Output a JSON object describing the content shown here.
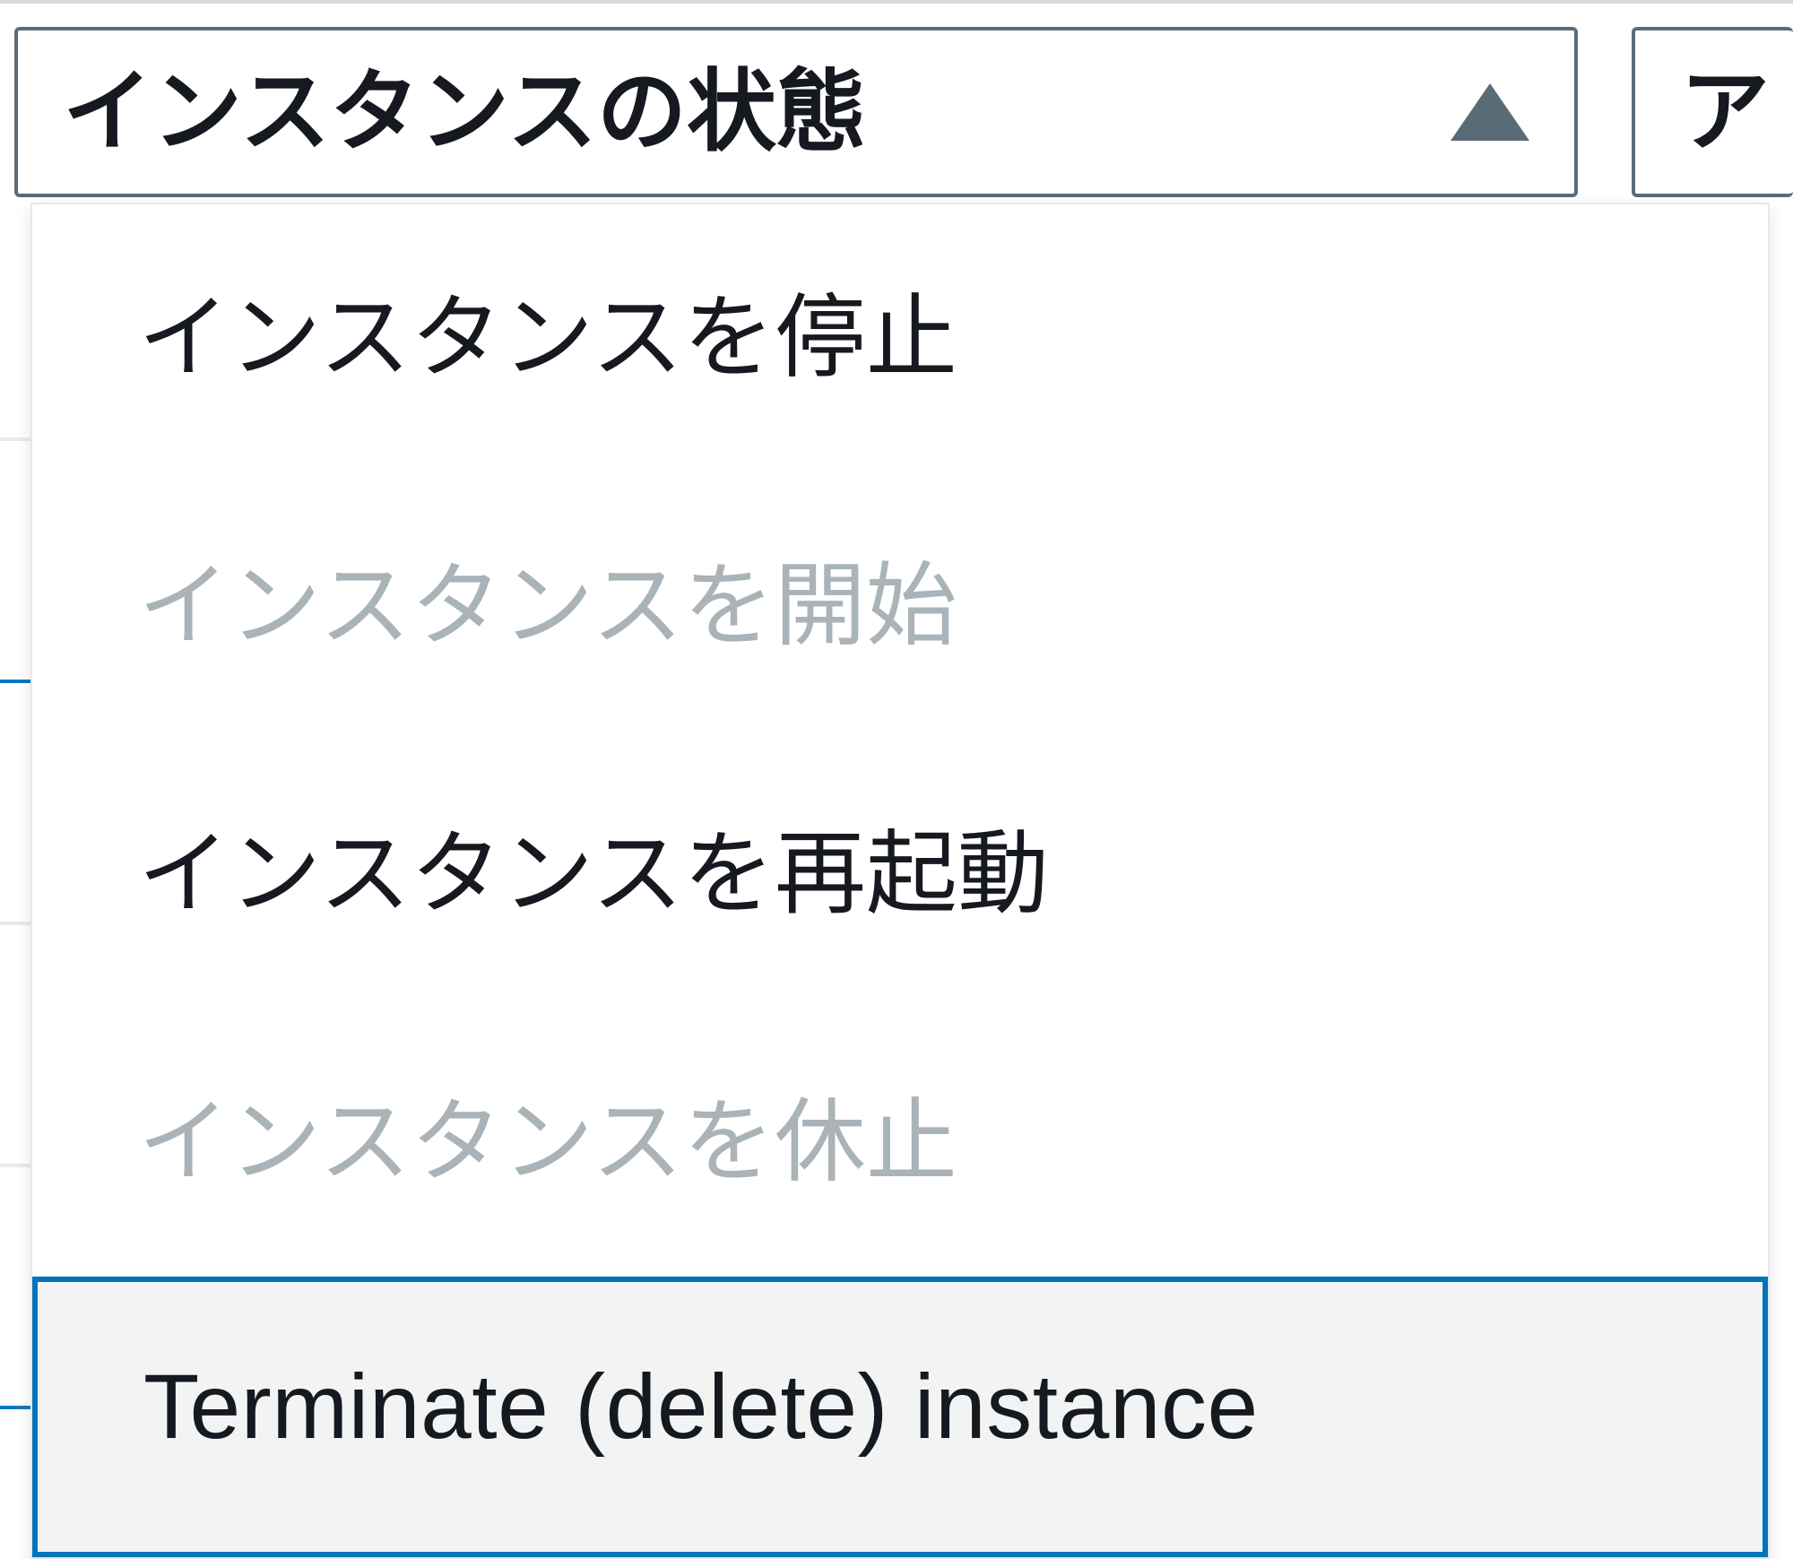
{
  "toolbar": {
    "instance_state": {
      "label": "インスタンスの状態"
    },
    "actions": {
      "label_clipped": "ア"
    }
  },
  "menu": {
    "items": [
      {
        "id": "stop",
        "label": "インスタンスを停止",
        "enabled": true,
        "selected": false
      },
      {
        "id": "start",
        "label": "インスタンスを開始",
        "enabled": false,
        "selected": false
      },
      {
        "id": "reboot",
        "label": "インスタンスを再起動",
        "enabled": true,
        "selected": false
      },
      {
        "id": "hibernate",
        "label": "インスタンスを休止",
        "enabled": false,
        "selected": false
      },
      {
        "id": "terminate",
        "label": "Terminate (delete) instance",
        "enabled": true,
        "selected": true
      }
    ]
  }
}
